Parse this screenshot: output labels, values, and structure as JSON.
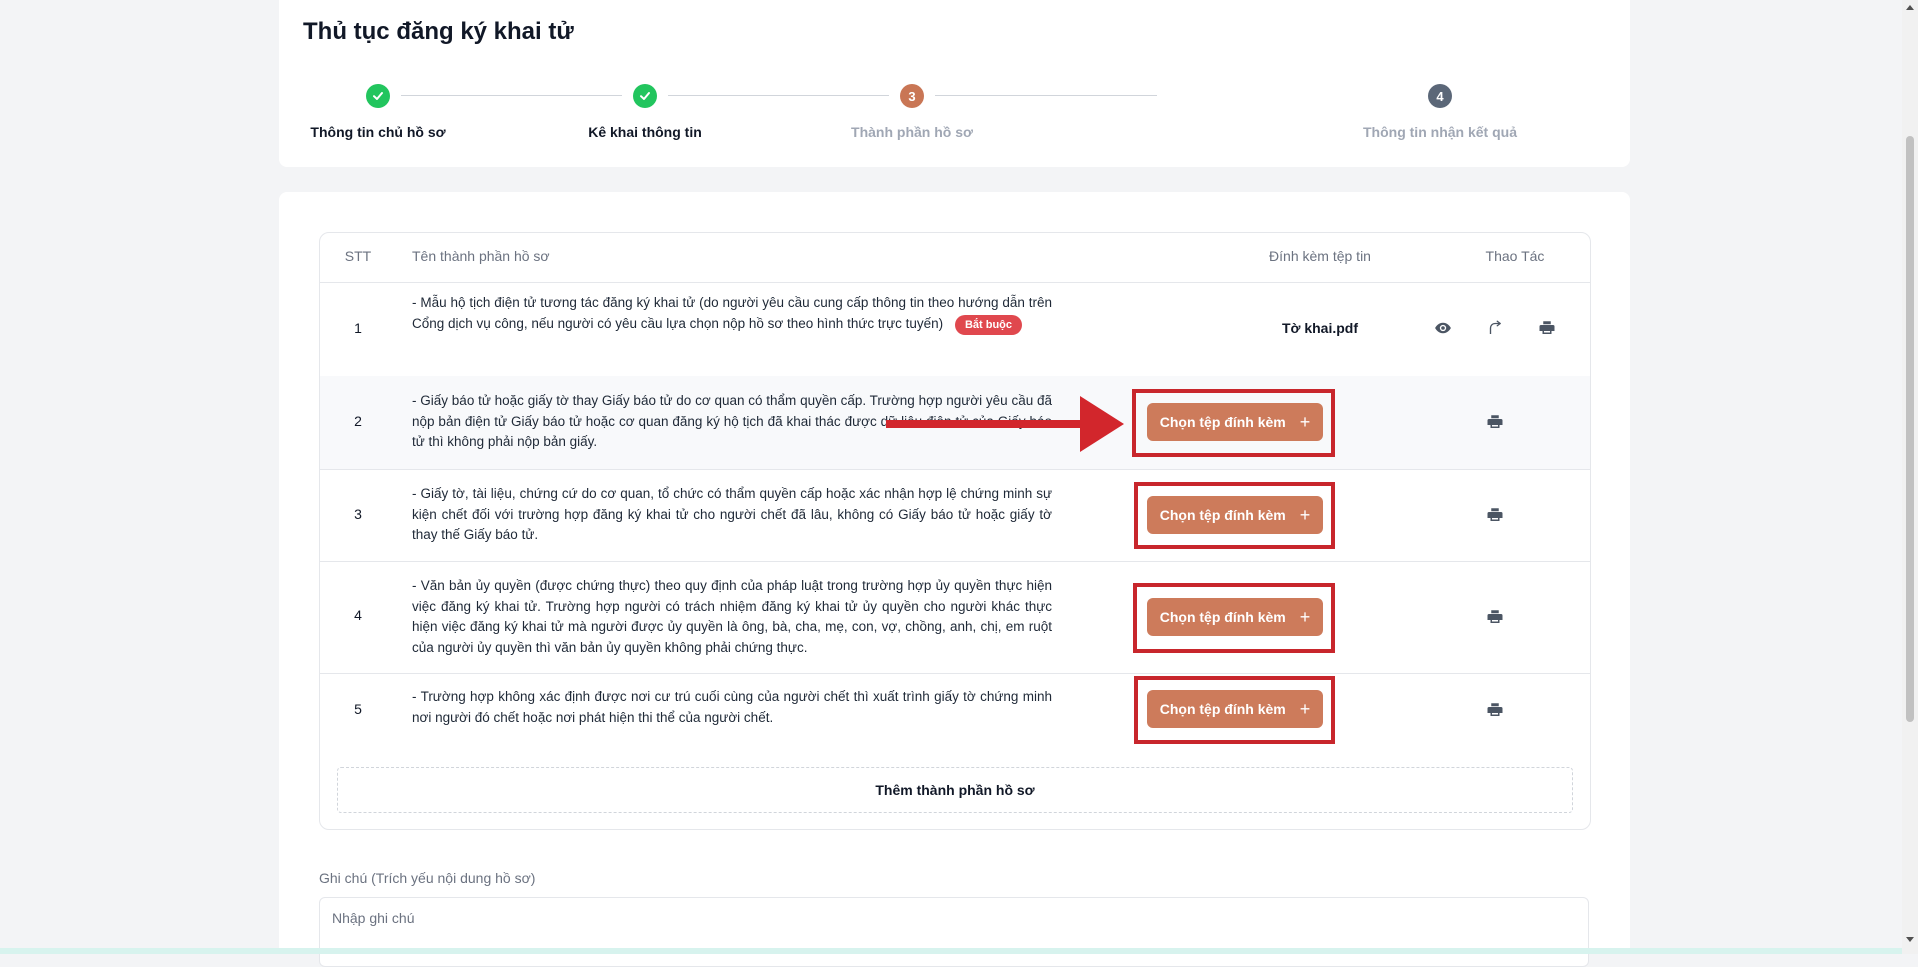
{
  "page": {
    "title": "Thủ tục đăng ký khai tử"
  },
  "steps": [
    {
      "number": "1",
      "label": "Thông tin chủ hồ sơ",
      "status": "done"
    },
    {
      "number": "2",
      "label": "Kê khai thông tin",
      "status": "done"
    },
    {
      "number": "3",
      "label": "Thành phần hồ sơ",
      "status": "current"
    },
    {
      "number": "4",
      "label": "Thông tin nhận kết quả",
      "status": "pending"
    }
  ],
  "table": {
    "headers": {
      "stt": "STT",
      "name": "Tên thành phần hồ sơ",
      "attach": "Đính kèm tệp tin",
      "actions": "Thao Tác"
    },
    "rows": [
      {
        "stt": "1",
        "description": "- Mẫu hộ tịch điện tử tương tác đăng ký khai tử (do người yêu cầu cung cấp thông tin theo hướng dẫn trên Cổng dịch vụ công, nếu người có yêu cầu lựa chọn nộp hồ sơ theo hình thức trực tuyến)",
        "badge": "Bắt buộc",
        "file": "Tờ khai.pdf"
      },
      {
        "stt": "2",
        "description": "- Giấy báo tử hoặc giấy tờ thay Giấy báo tử do cơ quan có thẩm quyền cấp. Trường hợp người yêu cầu đã nộp bản điện tử Giấy báo tử hoặc cơ quan đăng ký hộ tịch đã khai thác được dữ liệu điện tử của Giấy báo tử thì không phải nộp bản giấy.",
        "button": "Chọn tệp đính kèm"
      },
      {
        "stt": "3",
        "description": "- Giấy tờ, tài liệu, chứng cứ do cơ quan, tổ chức có thẩm quyền cấp hoặc xác nhận hợp lệ chứng minh sự kiện chết đối với trường hợp đăng ký khai tử cho người chết đã lâu, không có Giấy báo tử hoặc giấy tờ thay thế Giấy báo tử.",
        "button": "Chọn tệp đính kèm"
      },
      {
        "stt": "4",
        "description": "- Văn bản ủy quyền (được chứng thực) theo quy định của pháp luật trong trường hợp ủy quyền thực hiện việc đăng ký khai tử. Trường hợp người có trách nhiệm đăng ký khai tử ủy quyền cho người khác thực hiện việc đăng ký khai tử mà người được ủy quyền là ông, bà, cha, mẹ, con, vợ, chồng, anh, chị, em ruột của người ủy quyền thì văn bản ủy quyền không phải chứng thực.",
        "button": "Chọn tệp đính kèm"
      },
      {
        "stt": "5",
        "description": "- Trường hợp không xác định được nơi cư trú cuối cùng của người chết thì xuất trình giấy tờ chứng minh nơi người đó chết hoặc nơi phát hiện thi thể của người chết.",
        "button": "Chọn tệp đính kèm"
      }
    ],
    "add_label": "Thêm thành phần hồ sơ"
  },
  "note": {
    "label": "Ghi chú (Trích yếu nội dung hồ sơ)",
    "placeholder": "Nhập ghi chú"
  },
  "colors": {
    "step_done": "#22c55e",
    "step_current": "#c97655",
    "step_pending": "#5b6778",
    "attach_button": "#cd7b5b",
    "annotation_red": "#c8262c",
    "required_badge": "#e0484e"
  },
  "icons": [
    "check-icon",
    "eye-icon",
    "replace-icon",
    "printer-icon",
    "plus-icon",
    "arrow-annotation"
  ]
}
